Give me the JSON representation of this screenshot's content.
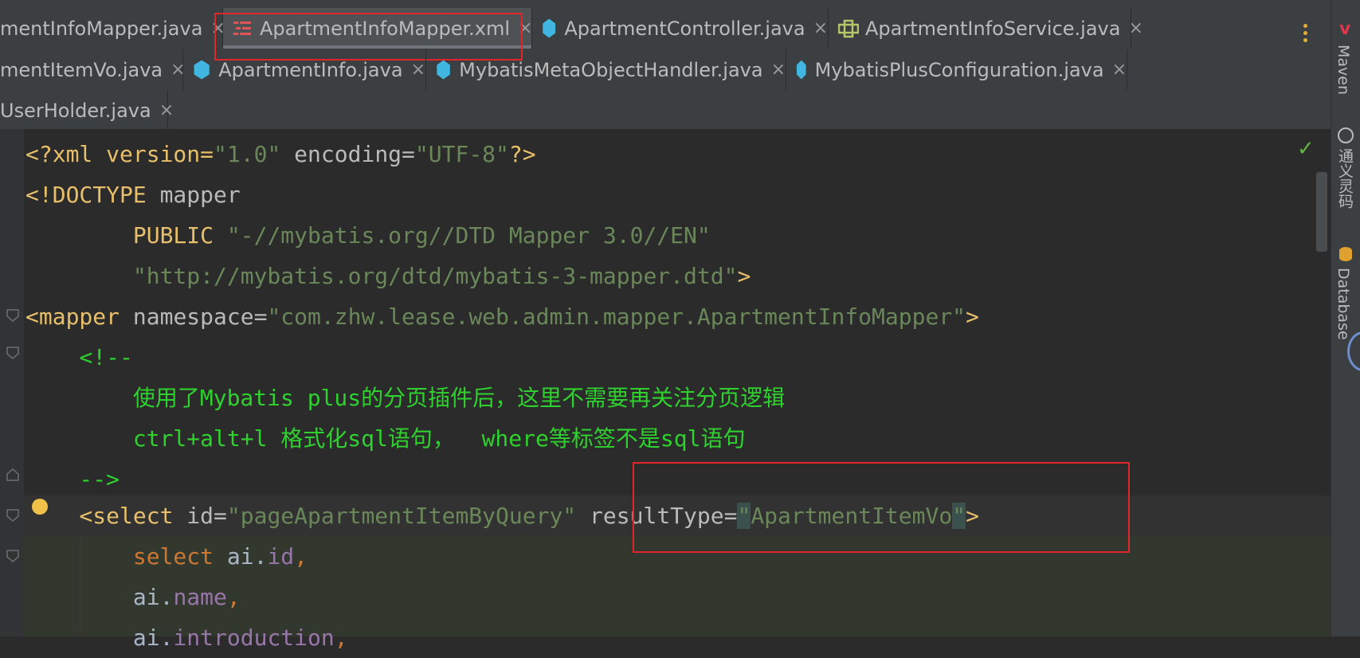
{
  "tabs": {
    "row1": [
      {
        "label": "mentInfoMapper.java",
        "icon": "none"
      },
      {
        "label": "ApartmentInfoMapper.xml",
        "icon": "xml-file-icon",
        "active": true
      },
      {
        "label": "ApartmentController.java",
        "icon": "java-class-icon"
      },
      {
        "label": "ApartmentInfoService.java",
        "icon": "interface-icon"
      }
    ],
    "row2": [
      {
        "label": "mentItemVo.java",
        "icon": "none"
      },
      {
        "label": "ApartmentInfo.java",
        "icon": "java-class-icon"
      },
      {
        "label": "MybatisMetaObjectHandler.java",
        "icon": "java-class-icon"
      },
      {
        "label": "MybatisPlusConfiguration.java",
        "icon": "java-class-icon"
      }
    ],
    "row3": [
      {
        "label": "UserHolder.java",
        "icon": "none"
      }
    ],
    "close_symbol": "×"
  },
  "right_toolbar": {
    "items": [
      {
        "label": "Maven",
        "icon": "maven-icon"
      },
      {
        "label": "通义灵码",
        "icon": "tongyi-icon"
      },
      {
        "label": "Database",
        "icon": "database-icon"
      }
    ]
  },
  "editor": {
    "status_icon": "✓",
    "code": {
      "l1": {
        "a": "<?xml version=",
        "b": "\"1.0\"",
        "c": " encoding=",
        "d": "\"UTF-8\"",
        "e": "?>"
      },
      "l2": {
        "a": "<!DOCTYPE",
        "b": " mapper"
      },
      "l3": {
        "a": "        PUBLIC ",
        "b": "\"-//mybatis.org//DTD Mapper 3.0//EN\""
      },
      "l4": {
        "a": "        ",
        "b": "\"http://mybatis.org/dtd/mybatis-3-mapper.dtd\"",
        "c": ">"
      },
      "l5": {
        "a": "<mapper",
        "b": " namespace=",
        "c": "\"com.zhw.lease.web.admin.mapper.ApartmentInfoMapper\"",
        "d": ">"
      },
      "l6": {
        "a": "    <!--"
      },
      "l7": {
        "a": "        使用了Mybatis plus的分页插件后，这里不需要再关注分页逻辑"
      },
      "l8": {
        "a": "        ctrl+alt+l 格式化sql语句，  where等标签不是sql语句"
      },
      "l9": {
        "a": "    -->"
      },
      "l10": {
        "a": "    <select",
        "b": " id=",
        "c": "\"pageApartmentItemByQuery\"",
        "d": " resultType=",
        "e": "\"",
        "f": "ApartmentItemVo",
        "g": "\"",
        "h": ">"
      },
      "l11": {
        "a": "        select ",
        "b": "ai.",
        "c": "id",
        "d": ","
      },
      "l12": {
        "a": "        ai.",
        "b": "name",
        "c": ","
      },
      "l13": {
        "a": "        ai.",
        "b": "introduction",
        "c": ","
      }
    }
  }
}
